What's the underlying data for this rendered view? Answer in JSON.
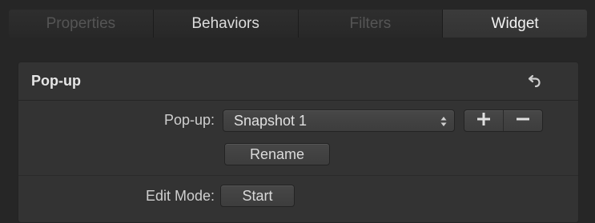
{
  "tabs": [
    {
      "label": "Properties",
      "active": false
    },
    {
      "label": "Behaviors",
      "active": false
    },
    {
      "label": "Filters",
      "active": false
    },
    {
      "label": "Widget",
      "active": true
    }
  ],
  "panel": {
    "title": "Pop-up",
    "reset_icon": "reset-arrow-icon",
    "popup_label": "Pop-up:",
    "popup_value": "Snapshot 1",
    "add_icon": "plus-icon",
    "remove_icon": "minus-icon",
    "rename_label": "Rename",
    "edit_mode_label": "Edit Mode:",
    "start_label": "Start"
  },
  "colors": {
    "background": "#262626",
    "panel": "#333333",
    "text": "#e6e6e6"
  }
}
